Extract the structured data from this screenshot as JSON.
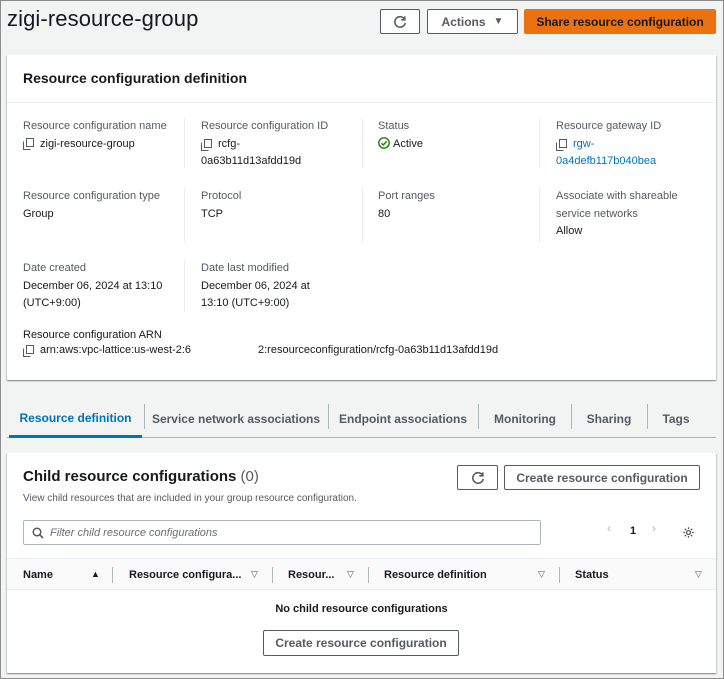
{
  "header": {
    "title": "zigi-resource-group",
    "actions_label": "Actions",
    "share_label": "Share resource configuration"
  },
  "definition": {
    "title": "Resource configuration definition",
    "name_label": "Resource configuration name",
    "name_value": "zigi-resource-group",
    "id_label": "Resource configuration ID",
    "id_value_line1": "rcfg-",
    "id_value_line2": "0a63b11d13afdd19d",
    "status_label": "Status",
    "status_value": "Active",
    "gateway_label": "Resource gateway ID",
    "gateway_value_line1": "rgw-",
    "gateway_value_line2": "0a4defb117b040bea",
    "type_label": "Resource configuration type",
    "type_value": "Group",
    "protocol_label": "Protocol",
    "protocol_value": "TCP",
    "ports_label": "Port ranges",
    "ports_value": "80",
    "shareable_label_line1": "Associate with shareable",
    "shareable_label_line2": "service networks",
    "shareable_value": "Allow",
    "created_label": "Date created",
    "created_line1": "December 06, 2024 at 13:10",
    "created_line2": "(UTC+9:00)",
    "modified_label": "Date last modified",
    "modified_line1": "December 06, 2024 at",
    "modified_line2": "13:10 (UTC+9:00)",
    "arn_label": "Resource configuration ARN",
    "arn_part1": "arn:aws:vpc-lattice:us-west-2:6",
    "arn_part2": "2:resourceconfiguration/rcfg-0a63b11d13afdd19d"
  },
  "tabs": [
    {
      "label": "Resource definition",
      "active": true
    },
    {
      "label": "Service network associations",
      "active": false
    },
    {
      "label": "Endpoint associations",
      "active": false
    },
    {
      "label": "Monitoring",
      "active": false
    },
    {
      "label": "Sharing",
      "active": false
    },
    {
      "label": "Tags",
      "active": false
    }
  ],
  "child": {
    "title": "Child resource configurations",
    "count": "(0)",
    "description": "View child resources that are included in your group resource configuration.",
    "create_label": "Create resource configuration",
    "search_placeholder": "Filter child resource configurations",
    "page": "1",
    "columns": [
      "Name",
      "Resource configura...",
      "Resour...",
      "Resource definition",
      "Status"
    ],
    "empty_text": "No child resource configurations",
    "empty_create_label": "Create resource configuration"
  },
  "colors": {
    "primary": "#ec7211",
    "link": "#0073bb",
    "success": "#1d8102"
  }
}
